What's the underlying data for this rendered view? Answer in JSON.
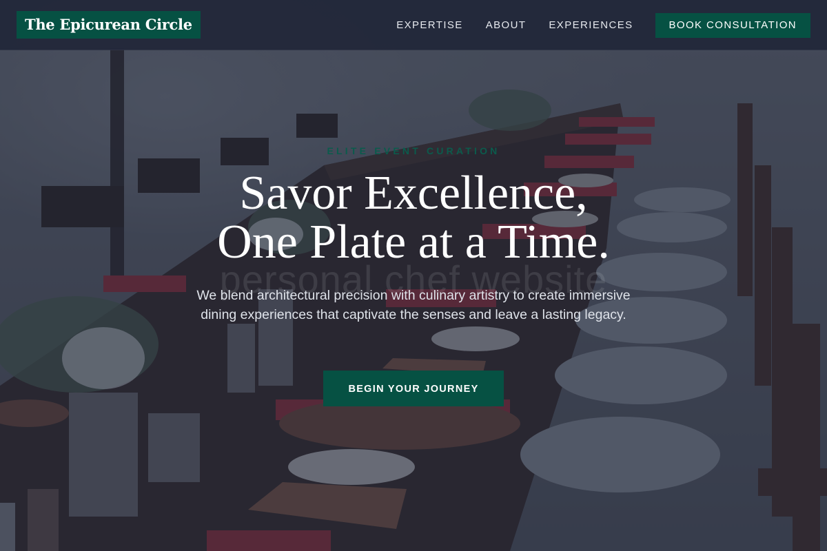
{
  "header": {
    "logo_text": "The Epicurean Circle",
    "nav": [
      {
        "label": "EXPERTISE"
      },
      {
        "label": "ABOUT"
      },
      {
        "label": "EXPERIENCES"
      }
    ],
    "cta_label": "BOOK CONSULTATION"
  },
  "hero": {
    "eyebrow": "ELITE EVENT CURATION",
    "title_line1": "Savor Excellence,",
    "title_line2": "One Plate at a Time.",
    "watermark": "personal chef website",
    "subtitle": "We blend architectural precision with culinary artistry to create immersive dining experiences that captivate the senses and leave a lasting legacy.",
    "cta_label": "BEGIN YOUR JOURNEY",
    "background_image": "banquet-table-photo"
  },
  "colors": {
    "brand_green": "#065143",
    "header_bg": "#22283a",
    "overlay": "#1e2438",
    "text_light": "#ffffff"
  }
}
